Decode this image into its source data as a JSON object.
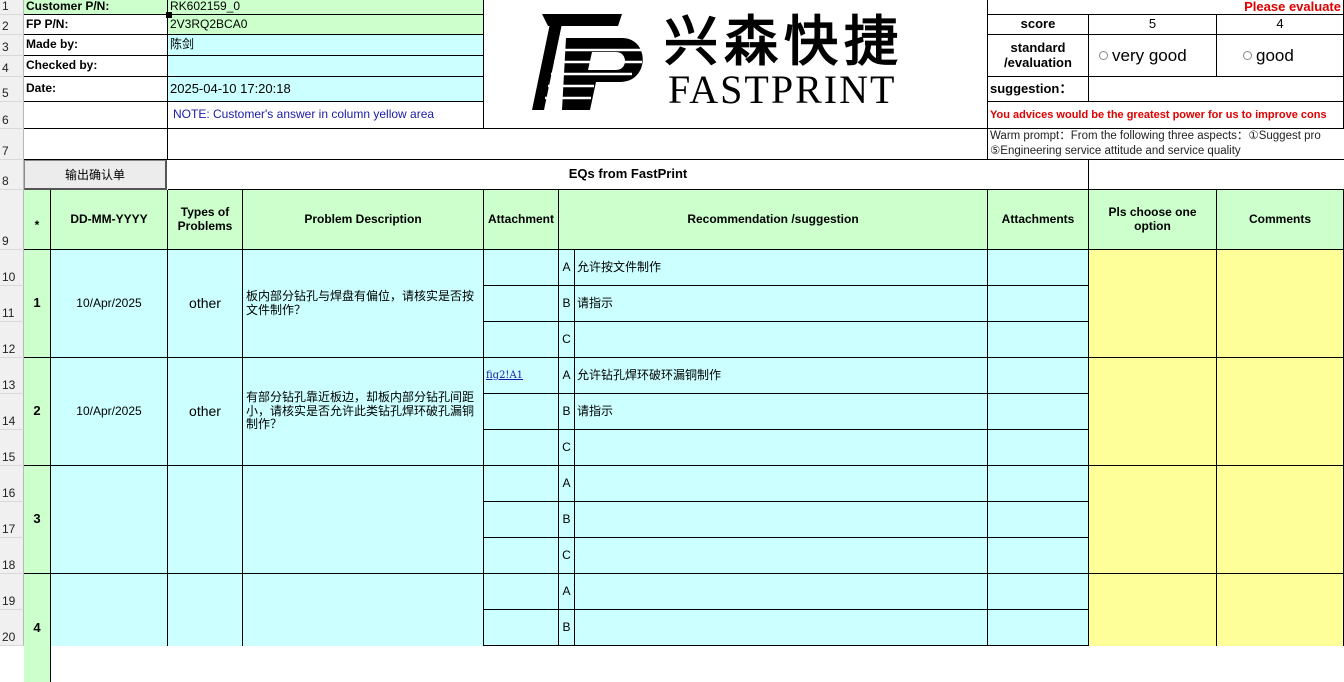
{
  "row_numbers": [
    "1",
    "2",
    "3",
    "4",
    "5",
    "6",
    "7",
    "8",
    "9",
    "10",
    "11",
    "12",
    "13",
    "14",
    "15",
    "16",
    "17",
    "18",
    "19",
    "20"
  ],
  "info": {
    "customer_pn_label": "Customer P/N:",
    "customer_pn": "RK602159_0",
    "fp_pn_label": "FP P/N:",
    "fp_pn": "2V3RQ2BCA0",
    "made_by_label": "Made by:",
    "made_by": "陈剑",
    "checked_by_label": "Checked by:",
    "checked_by": "",
    "date_label": "Date:",
    "date": "2025-04-10 17:20:18",
    "note": "NOTE: Customer's  answer in column yellow area"
  },
  "logo": {
    "chinese": "兴森快捷",
    "english": "FASTPRINT",
    "letter": "F"
  },
  "evaluation": {
    "title": "Please evaluate",
    "score_label": "score",
    "score_5": "5",
    "score_4": "4",
    "standard_label": "standard /evaluation",
    "very_good": "very good",
    "good": "good",
    "suggestion_label": "suggestion：",
    "advice_text": "You advices would be the greatest power for us to improve cons",
    "warm_prompt": "Warm prompt：From the following three aspects：①Suggest pro",
    "warm_prompt_2": "⑤Engineering service attitude and service quality"
  },
  "toolbar": {
    "output_button": "输出确认单",
    "eqs_title": "EQs from FastPrint"
  },
  "headers": {
    "star": "*",
    "date": "DD-MM-YYYY",
    "types": "Types of Problems",
    "desc": "Problem Description",
    "attachment": "Attachment",
    "recommendation": "Recommendation /suggestion",
    "attachments": "Attachments",
    "choose": "Pls choose one option",
    "comments": "Comments"
  },
  "eqs": [
    {
      "num": "1",
      "date": "10/Apr/2025",
      "type": "other",
      "desc": "板内部分钻孔与焊盘有偏位，请核实是否按文件制作？",
      "attachment": "",
      "options": [
        {
          "letter": "A",
          "text": "允许按文件制作"
        },
        {
          "letter": "B",
          "text": "请指示"
        },
        {
          "letter": "C",
          "text": ""
        }
      ]
    },
    {
      "num": "2",
      "date": "10/Apr/2025",
      "type": "other",
      "desc": "有部分钻孔靠近板边，却板内部分钻孔间距小，请核实是否允许此类钻孔焊环破孔漏铜制作？",
      "attachment": "fig2!A1",
      "options": [
        {
          "letter": "A",
          "text": "允许钻孔焊环破环漏铜制作"
        },
        {
          "letter": "B",
          "text": "请指示"
        },
        {
          "letter": "C",
          "text": ""
        }
      ]
    },
    {
      "num": "3",
      "date": "",
      "type": "",
      "desc": "",
      "attachment": "",
      "options": [
        {
          "letter": "A",
          "text": ""
        },
        {
          "letter": "B",
          "text": ""
        },
        {
          "letter": "C",
          "text": ""
        }
      ]
    },
    {
      "num": "4",
      "date": "",
      "type": "",
      "desc": "",
      "attachment": "",
      "options": [
        {
          "letter": "A",
          "text": ""
        },
        {
          "letter": "B",
          "text": ""
        }
      ]
    }
  ]
}
